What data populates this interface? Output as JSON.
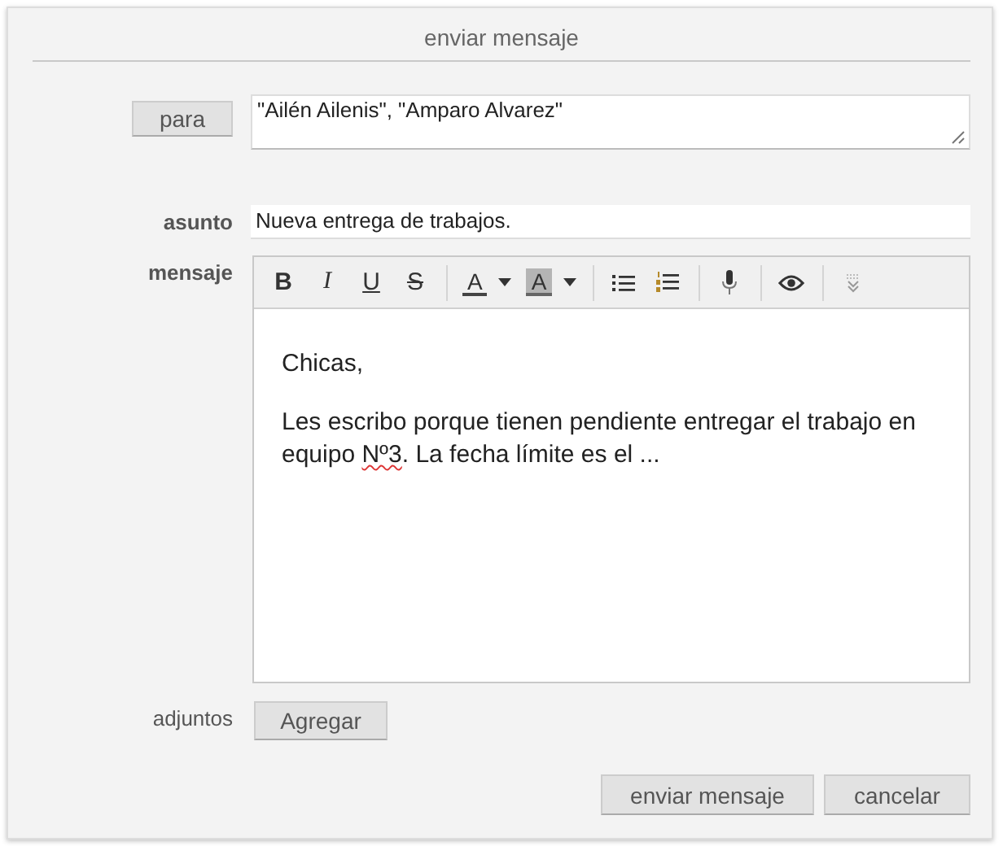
{
  "dialog": {
    "title": "enviar mensaje"
  },
  "to": {
    "button": "para",
    "value": "\"Ailén Ailenis\", \"Amparo Alvarez\""
  },
  "subject": {
    "label": "asunto",
    "value": "Nueva entrega de trabajos."
  },
  "message": {
    "label": "mensaje",
    "toolbar": [
      {
        "items": [
          {
            "kind": "bold",
            "label": "B"
          },
          {
            "kind": "italic",
            "label": "I"
          },
          {
            "kind": "underline",
            "label": "U"
          },
          {
            "kind": "strike",
            "label": "S"
          }
        ]
      },
      {
        "items": [
          {
            "kind": "font-color",
            "label": "A"
          },
          {
            "kind": "highlight",
            "label": "A"
          }
        ]
      },
      {
        "items": [
          {
            "kind": "bullets"
          },
          {
            "kind": "numbers"
          }
        ]
      },
      {
        "items": [
          {
            "kind": "mic"
          }
        ]
      },
      {
        "items": [
          {
            "kind": "eye"
          }
        ]
      },
      {
        "items": [
          {
            "kind": "more"
          }
        ]
      }
    ],
    "paragraphs": [
      [
        {
          "text": "Chicas,",
          "misspelled": false
        }
      ],
      [
        {
          "text": "Les escribo porque tienen pendiente entregar el trabajo en equipo ",
          "misspelled": false
        },
        {
          "text": "Nº3",
          "misspelled": true
        },
        {
          "text": ". La fecha límite es el ...",
          "misspelled": false
        }
      ]
    ]
  },
  "attachments": {
    "label": "adjuntos",
    "button": "Agregar"
  },
  "buttons": [
    "enviar mensaje",
    "cancelar"
  ]
}
